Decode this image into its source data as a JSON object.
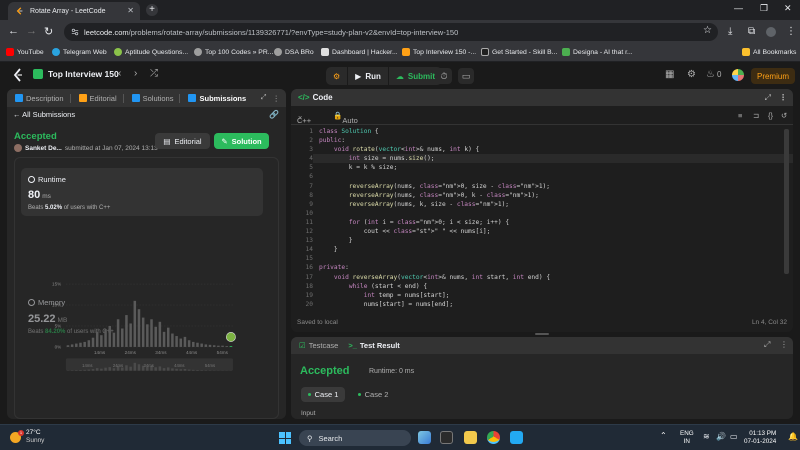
{
  "browser": {
    "tab_title": "Rotate Array - LeetCode",
    "url_host": "leetcode.com",
    "url_path": "/problems/rotate-array/submissions/1139326771/?envType=study-plan-v2&envId=top-interview-150",
    "bookmarks": [
      "YouTube",
      "Telegram Web",
      "Aptitude Questions...",
      "Top 100 Codes » PR...",
      "DSA BRo",
      "Dashboard | Hacker...",
      "Top Interview 150 -...",
      "Get Started - Skill B...",
      "Designa - AI that r..."
    ],
    "all_bookmarks": "All Bookmarks"
  },
  "nav": {
    "problem_list": "Top Interview 150",
    "run": "Run",
    "submit": "Submit",
    "streak": "0",
    "premium": "Premium"
  },
  "left": {
    "tabs": [
      "Description",
      "Editorial",
      "Solutions",
      "Submissions"
    ],
    "all_submissions": "All Submissions",
    "status": "Accepted",
    "user": "Sanket De...",
    "submitted": "submitted at Jan 07, 2024 13:13",
    "editorial_btn": "Editorial",
    "solution_btn": "Solution",
    "runtime_label": "Runtime",
    "runtime_value": "80",
    "runtime_unit": "ms",
    "runtime_beats_prefix": "Beats",
    "runtime_beats": "5.02%",
    "runtime_beats_suffix": "of users with C++",
    "memory_label": "Memory",
    "memory_value": "25.22",
    "memory_unit": "MB",
    "memory_beats_prefix": "Beats",
    "memory_beats": "84.20%",
    "memory_beats_suffix": "of users with C++"
  },
  "chart_data": {
    "type": "bar",
    "y_ticks": [
      "15%",
      "10%",
      "5%",
      "0%"
    ],
    "x_ticks": [
      "14ms",
      "24ms",
      "34ms",
      "44ms",
      "54ms"
    ],
    "ylim": [
      0,
      15
    ],
    "values": [
      0.4,
      0.6,
      0.8,
      1.0,
      1.2,
      1.6,
      2.2,
      3.6,
      2.8,
      4.2,
      5.0,
      3.4,
      6.6,
      4.4,
      7.6,
      5.6,
      11.0,
      9.0,
      7.0,
      5.4,
      6.6,
      4.8,
      6.0,
      3.6,
      4.6,
      3.2,
      2.6,
      2.0,
      2.4,
      1.6,
      1.2,
      1.0,
      0.8,
      0.6,
      0.5,
      0.4,
      0.3,
      0.3,
      0.2,
      0.2
    ],
    "highlight_index": 39
  },
  "code": {
    "title": "Code",
    "language": "C++",
    "mode": "Auto",
    "saved": "Saved to local",
    "cursor": "Ln 4, Col 32",
    "lines": [
      "class Solution {",
      "public:",
      "    void rotate(vector<int>& nums, int k) {",
      "        int size = nums.size();",
      "        k = k % size;",
      "",
      "        reverseArray(nums, 0, size - 1);",
      "        reverseArray(nums, 0, k - 1);",
      "        reverseArray(nums, k, size - 1);",
      "",
      "        for (int i = 0; i < size; i++) {",
      "            cout << \" \" << nums[i];",
      "        }",
      "    }",
      "",
      "private:",
      "    void reverseArray(vector<int>& nums, int start, int end) {",
      "        while (start < end) {",
      "            int temp = nums[start];",
      "            nums[start] = nums[end];"
    ]
  },
  "test": {
    "tab_testcase": "Testcase",
    "tab_result": "Test Result",
    "status": "Accepted",
    "runtime": "Runtime: 0 ms",
    "case1": "Case 1",
    "case2": "Case 2",
    "input_label": "Input"
  },
  "taskbar": {
    "temp": "27°C",
    "weather": "Sunny",
    "search": "Search",
    "lang1": "ENG",
    "lang2": "IN",
    "time": "01:13 PM",
    "date": "07-01-2024"
  }
}
